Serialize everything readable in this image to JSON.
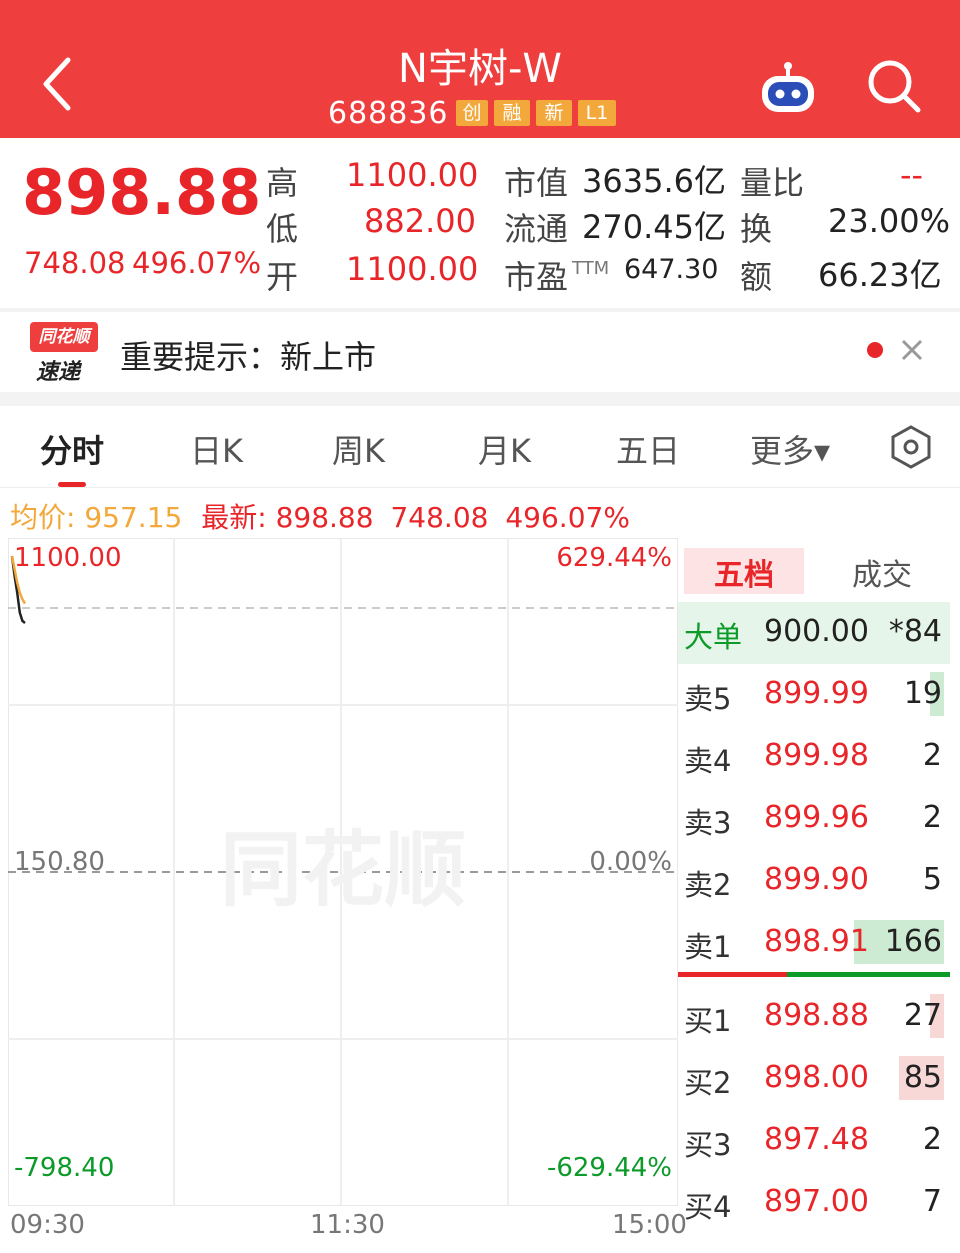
{
  "header": {
    "title": "N宇树-W",
    "code": "688836",
    "tags": [
      "创",
      "融",
      "新",
      "L1"
    ]
  },
  "quote": {
    "price": "898.88",
    "change": "748.08",
    "change_pct": "496.07%",
    "high_label": "高",
    "high": "1100.00",
    "low_label": "低",
    "low": "882.00",
    "open_label": "开",
    "open": "1100.00",
    "mktcap_label": "市值",
    "mktcap": "3635.6亿",
    "float_label": "流通",
    "float": "270.45亿",
    "pe_label": "市盈",
    "pe_sup": "TTM",
    "pe": "647.30",
    "volratio_label": "量比",
    "volratio": "--",
    "turnover_label": "换",
    "turnover": "23.00%",
    "amount_label": "额",
    "amount": "66.23亿"
  },
  "notice": {
    "logo_top": "同花顺",
    "logo_bottom": "速递",
    "text": "重要提示：新上市"
  },
  "tabs": [
    "分时",
    "日K",
    "周K",
    "月K",
    "五日",
    "更多▾"
  ],
  "info": {
    "avg_label": "均价:",
    "avg": "957.15",
    "latest_label": "最新:",
    "latest": "898.88",
    "change": "748.08",
    "change_pct": "496.07%"
  },
  "chart_data": {
    "type": "line",
    "y_top_label": "1100.00",
    "y_mid_label": "150.80",
    "y_bottom_label": "-798.40",
    "pct_top_label": "629.44%",
    "pct_mid_label": "0.00%",
    "pct_bottom_label": "-629.44%",
    "x_ticks": [
      "09:30",
      "11:30",
      "15:00"
    ],
    "ylim": [
      -798.4,
      1100.0
    ],
    "prev_close": 150.8,
    "series": [
      {
        "color": "#222222",
        "x": [
          0,
          1,
          2,
          3,
          4,
          5
        ],
        "values": [
          1100.0,
          1040.0,
          990.0,
          930.0,
          905.0,
          898.88
        ]
      },
      {
        "color": "#f3a83b",
        "x": [
          0,
          1,
          2,
          3,
          4,
          5
        ],
        "values": [
          1100.0,
          1060.0,
          1020.0,
          990.0,
          970.0,
          957.15
        ]
      }
    ],
    "watermark": "同花顺"
  },
  "book": {
    "tab_active": "五档",
    "tab_other": "成交",
    "big": {
      "label": "大单",
      "price": "900.00",
      "vol": "*84"
    },
    "asks": [
      {
        "label": "卖5",
        "price": "899.99",
        "vol": "19",
        "bar": 0.06
      },
      {
        "label": "卖4",
        "price": "899.98",
        "vol": "2",
        "bar": 0.0
      },
      {
        "label": "卖3",
        "price": "899.96",
        "vol": "2",
        "bar": 0.0
      },
      {
        "label": "卖2",
        "price": "899.90",
        "vol": "5",
        "bar": 0.0
      },
      {
        "label": "卖1",
        "price": "898.91",
        "vol": "166",
        "bar": 1.0
      }
    ],
    "bids": [
      {
        "label": "买1",
        "price": "898.88",
        "vol": "27",
        "bar": 0.16
      },
      {
        "label": "买2",
        "price": "898.00",
        "vol": "85",
        "bar": 0.5
      },
      {
        "label": "买3",
        "price": "897.48",
        "vol": "2",
        "bar": 0.0
      },
      {
        "label": "买4",
        "price": "897.00",
        "vol": "7",
        "bar": 0.0
      }
    ],
    "split_ratio": 0.4
  },
  "colors": {
    "header_red": "#ee3e3e",
    "price_red": "#e8262a",
    "down_green": "#0c9a29",
    "tag_orange": "#f3a83b",
    "ask_bar": "#cdebd3",
    "bid_bar": "#f8d7d7"
  }
}
